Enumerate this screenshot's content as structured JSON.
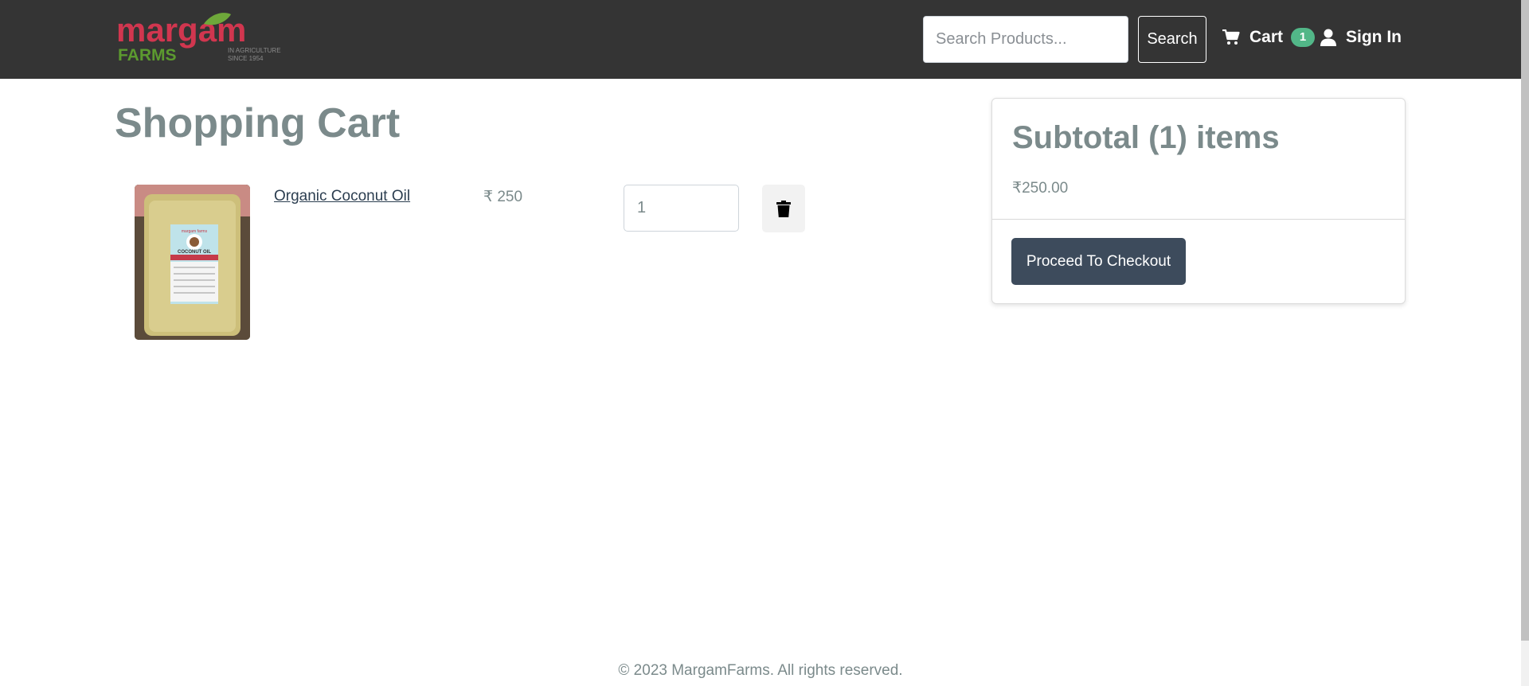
{
  "header": {
    "logo": {
      "wordmark": "margam",
      "sub": "FARMS",
      "tagline_1": "IN AGRICULTURE",
      "tagline_2": "SINCE 1954"
    },
    "search": {
      "placeholder": "Search Products...",
      "button_label": "Search"
    },
    "cart": {
      "label": "Cart",
      "count": "1"
    },
    "signin_label": "Sign In"
  },
  "main": {
    "title": "Shopping Cart",
    "items": [
      {
        "name": "Organic Coconut Oil",
        "price": "₹ 250",
        "quantity": "1",
        "image_label_brand": "margam farms",
        "image_label_product": "COCONUT OIL"
      }
    ]
  },
  "summary": {
    "title": "Subtotal (1) items",
    "amount": "₹250.00",
    "checkout_label": "Proceed To Checkout"
  },
  "footer": {
    "copyright": "© 2023 MargamFarms. All rights reserved."
  },
  "colors": {
    "navbar": "#343434",
    "accent_green": "#52b788",
    "brand_red": "#d1364f",
    "brand_green": "#5c9a2f",
    "checkout": "#3d4b5c",
    "heading_gray": "#7b8a8b"
  }
}
